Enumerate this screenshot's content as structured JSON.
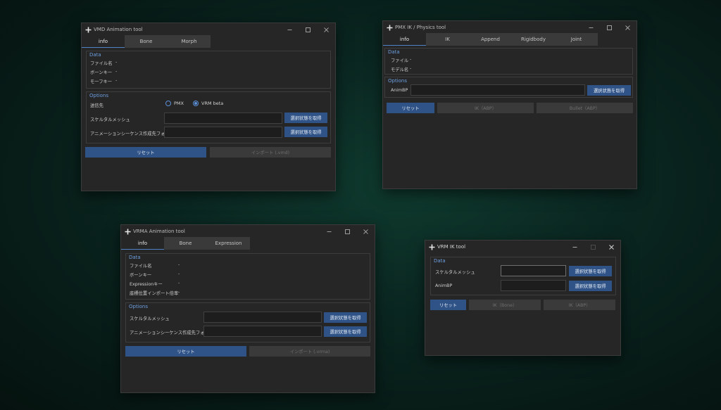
{
  "colors": {
    "accent": "#2f5387",
    "group_title": "#6e9fe0",
    "window_bg": "#262626"
  },
  "icons": {
    "app": "plus-icon",
    "minimize": "minimize-icon",
    "maximize": "maximize-icon",
    "close": "close-icon"
  },
  "vmd": {
    "title": "VMD Animation tool",
    "tabs": [
      "info",
      "Bone",
      "Morph"
    ],
    "data_title": "Data",
    "data_rows": [
      {
        "label": "ファイル名",
        "value": "-"
      },
      {
        "label": "ボーンキー",
        "value": "-"
      },
      {
        "label": "モーフキー",
        "value": "-"
      }
    ],
    "options_title": "Options",
    "target_label": "送信先",
    "radio_pmx": "PMX",
    "radio_vrm": "VRM beta",
    "selected": "VRM beta",
    "skeletal_label": "スケルタルメッシュ",
    "folder_label": "アニメーションシーケンス作成先フォルダ",
    "get_selection": "選択状態を取得",
    "reset": "リセット",
    "import": "インポート (.vmd)"
  },
  "pmx": {
    "title": "PMX IK / Physics tool",
    "tabs": [
      "info",
      "IK",
      "Append",
      "Rigidbody",
      "Joint"
    ],
    "data_title": "Data",
    "data_rows": [
      {
        "label": "ファイル",
        "value": "-"
      },
      {
        "label": "モデル名",
        "value": "-"
      }
    ],
    "options_title": "Options",
    "animbp_label": "AnimBP",
    "get_selection": "選択状態を取得",
    "reset": "リセット",
    "ik_abp": "IK（ABP）",
    "bullet_abp": "Bullet（ABP）"
  },
  "vrma": {
    "title": "VRMA Animation tool",
    "tabs": [
      "info",
      "Bone",
      "Expression"
    ],
    "data_title": "Data",
    "data_rows": [
      {
        "label": "ファイル名",
        "value": "-"
      },
      {
        "label": "ボーンキー",
        "value": "-"
      },
      {
        "label": "Expressionキー",
        "value": "-"
      },
      {
        "label": "座標位置インポート倍率",
        "value": "-"
      }
    ],
    "options_title": "Options",
    "skeletal_label": "スケルタルメッシュ",
    "folder_label": "アニメーションシーケンス作成先フォルダ",
    "get_selection": "選択状態を取得",
    "reset": "リセット",
    "import": "インポート (.vrma)"
  },
  "vrmik": {
    "title": "VRM IK tool",
    "data_title": "Data",
    "skeletal_label": "スケルタルメッシュ",
    "animbp_label": "AnimBP",
    "get_selection": "選択状態を取得",
    "reset": "リセット",
    "ik_bone": "IK（Bone）",
    "ik_abp": "IK（ABP）"
  }
}
